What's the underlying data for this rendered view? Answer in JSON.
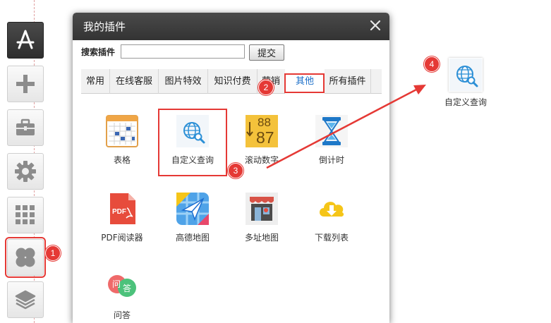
{
  "dialog": {
    "title": "我的插件",
    "search_label": "搜索插件",
    "search_value": "",
    "search_button": "提交"
  },
  "tabs": [
    {
      "label": "常用"
    },
    {
      "label": "在线客服"
    },
    {
      "label": "图片特效"
    },
    {
      "label": "知识付费"
    },
    {
      "label": "营销"
    },
    {
      "label": "其他",
      "active": true
    },
    {
      "label": "所有插件"
    }
  ],
  "plugins": [
    {
      "label": "表格",
      "icon": "table-icon"
    },
    {
      "label": "自定义查询",
      "icon": "custom-query-icon"
    },
    {
      "label": "滚动数字",
      "icon": "rolling-number-icon"
    },
    {
      "label": "倒计时",
      "icon": "hourglass-icon"
    },
    {
      "label": "PDF阅读器",
      "icon": "pdf-icon"
    },
    {
      "label": "高德地图",
      "icon": "amap-icon"
    },
    {
      "label": "多址地图",
      "icon": "store-map-icon"
    },
    {
      "label": "下载列表",
      "icon": "download-cloud-icon"
    },
    {
      "label": "问答",
      "icon": "qa-bubble-icon"
    }
  ],
  "rolling_digits": {
    "top": "88",
    "bottom": "87"
  },
  "qa_icon_text": {
    "left": "问",
    "right": "答"
  },
  "pdf_icon_text": "PDF",
  "floating_plugin": {
    "label": "自定义查询"
  },
  "badges": {
    "one": "1",
    "two": "2",
    "three": "3",
    "four": "4"
  },
  "sidebar": [
    "app-store-icon",
    "plus-icon",
    "toolbox-icon",
    "gear-icon",
    "grid-icon",
    "plugin-clover-icon",
    "layers-icon"
  ],
  "colors": {
    "highlight": "#e53935",
    "active_tab": "#1a6ec8",
    "header": "#3a3a3a"
  }
}
